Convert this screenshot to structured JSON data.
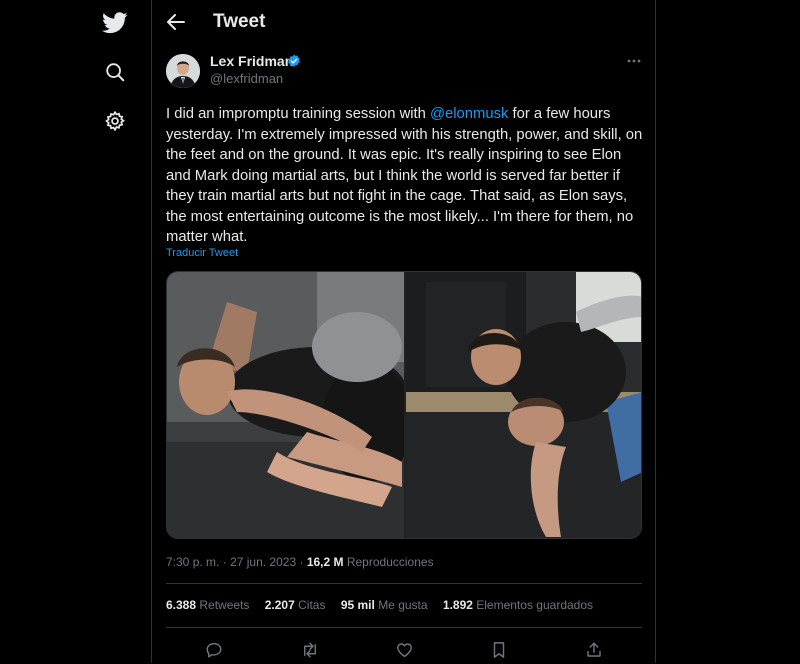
{
  "sidebar": {
    "logo_icon": "twitter-bird-icon",
    "items": [
      {
        "icon": "search-icon"
      },
      {
        "icon": "gear-icon"
      }
    ]
  },
  "header": {
    "title": "Tweet",
    "back_icon": "back-arrow-icon"
  },
  "tweet": {
    "author_name": "Lex Fridman",
    "author_handle": "@lexfridman",
    "text_before": "I did an impromptu training session with ",
    "mention": "@elonmusk",
    "text_after": " for a few hours yesterday. I'm extremely impressed with his strength, power, and skill, on the feet and on the ground. It was epic. It's really inspiring to see Elon and Mark doing martial arts, but I think the world is served far better if they train martial arts but not fight in the cage. That said, as Elon says, the most entertaining outcome is the most likely... I'm there for them, no matter what.",
    "translate_link": "Traducir Tweet",
    "time": "7:30 p. m.",
    "separator": "·",
    "date": "27 jun. 2023",
    "views_count": "16,2 M",
    "views_label": "Reproducciones",
    "stats": [
      {
        "count": "6.388",
        "label": "Retweets"
      },
      {
        "count": "2.207",
        "label": "Citas"
      },
      {
        "count": "95 mil",
        "label": "Me gusta"
      },
      {
        "count": "1.892",
        "label": "Elementos guardados"
      }
    ]
  },
  "actions": [
    "reply-icon",
    "retweet-icon",
    "like-icon",
    "bookmark-icon",
    "share-icon"
  ],
  "colors": {
    "background": "#000000",
    "text": "#e7e9ea",
    "muted": "#71767b",
    "accent": "#1d9bf0",
    "border": "#2f3336"
  }
}
